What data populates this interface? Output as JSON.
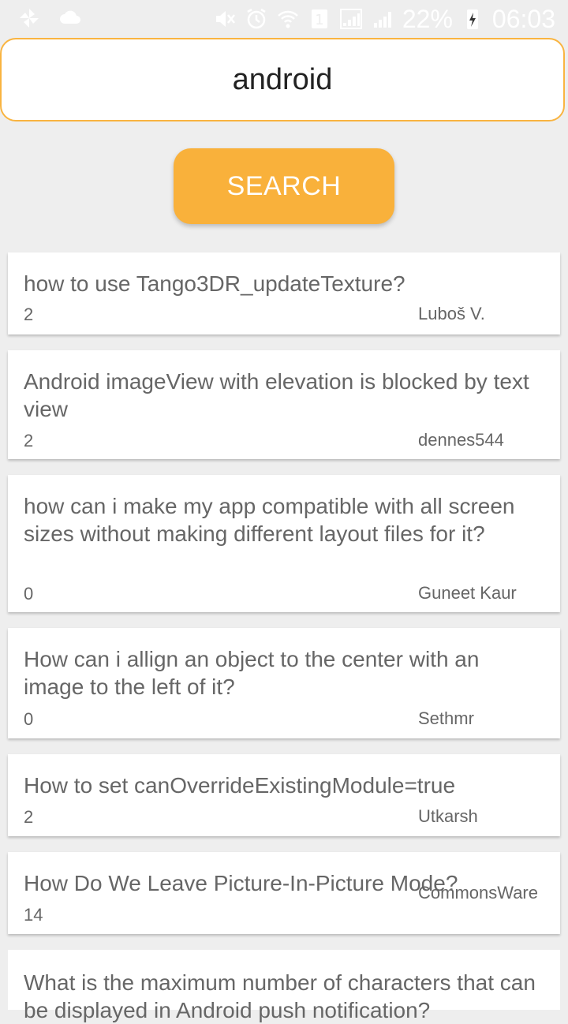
{
  "status_bar": {
    "battery": "22%",
    "time": "06:03",
    "sim_slot": "1",
    "icons": [
      "pinwheel-icon",
      "cloud-icon",
      "mute-icon",
      "alarm-icon",
      "wifi-icon",
      "sim-icon",
      "signal-icon",
      "signal-icon",
      "charging-icon"
    ]
  },
  "search": {
    "query": "android",
    "button_label": "SEARCH"
  },
  "results": [
    {
      "title": "how to use Tango3DR_updateTexture?",
      "score": "2",
      "author": "Luboš V."
    },
    {
      "title": "Android imageView with elevation is blocked by text view",
      "score": "2",
      "author": "dennes544"
    },
    {
      "title": "how can i make my app compatible with all screen sizes without making different layout files for it?",
      "score": "0",
      "author": "Guneet Kaur"
    },
    {
      "title": "How can i allign an object to the center with an image to the left of it?",
      "score": "0",
      "author": "Sethmr"
    },
    {
      "title": "How to set canOverrideExistingModule=true",
      "score": "2",
      "author": "Utkarsh"
    },
    {
      "title": "How Do We Leave Picture-In-Picture Mode?",
      "score": "14",
      "author": "CommonsWare"
    },
    {
      "title": "What is the maximum number of characters that can be displayed in Android push notification?",
      "score": "",
      "author": ""
    }
  ],
  "colors": {
    "accent": "#f9b13b",
    "background": "#eeeeee",
    "card": "#ffffff",
    "text": "#666666"
  }
}
